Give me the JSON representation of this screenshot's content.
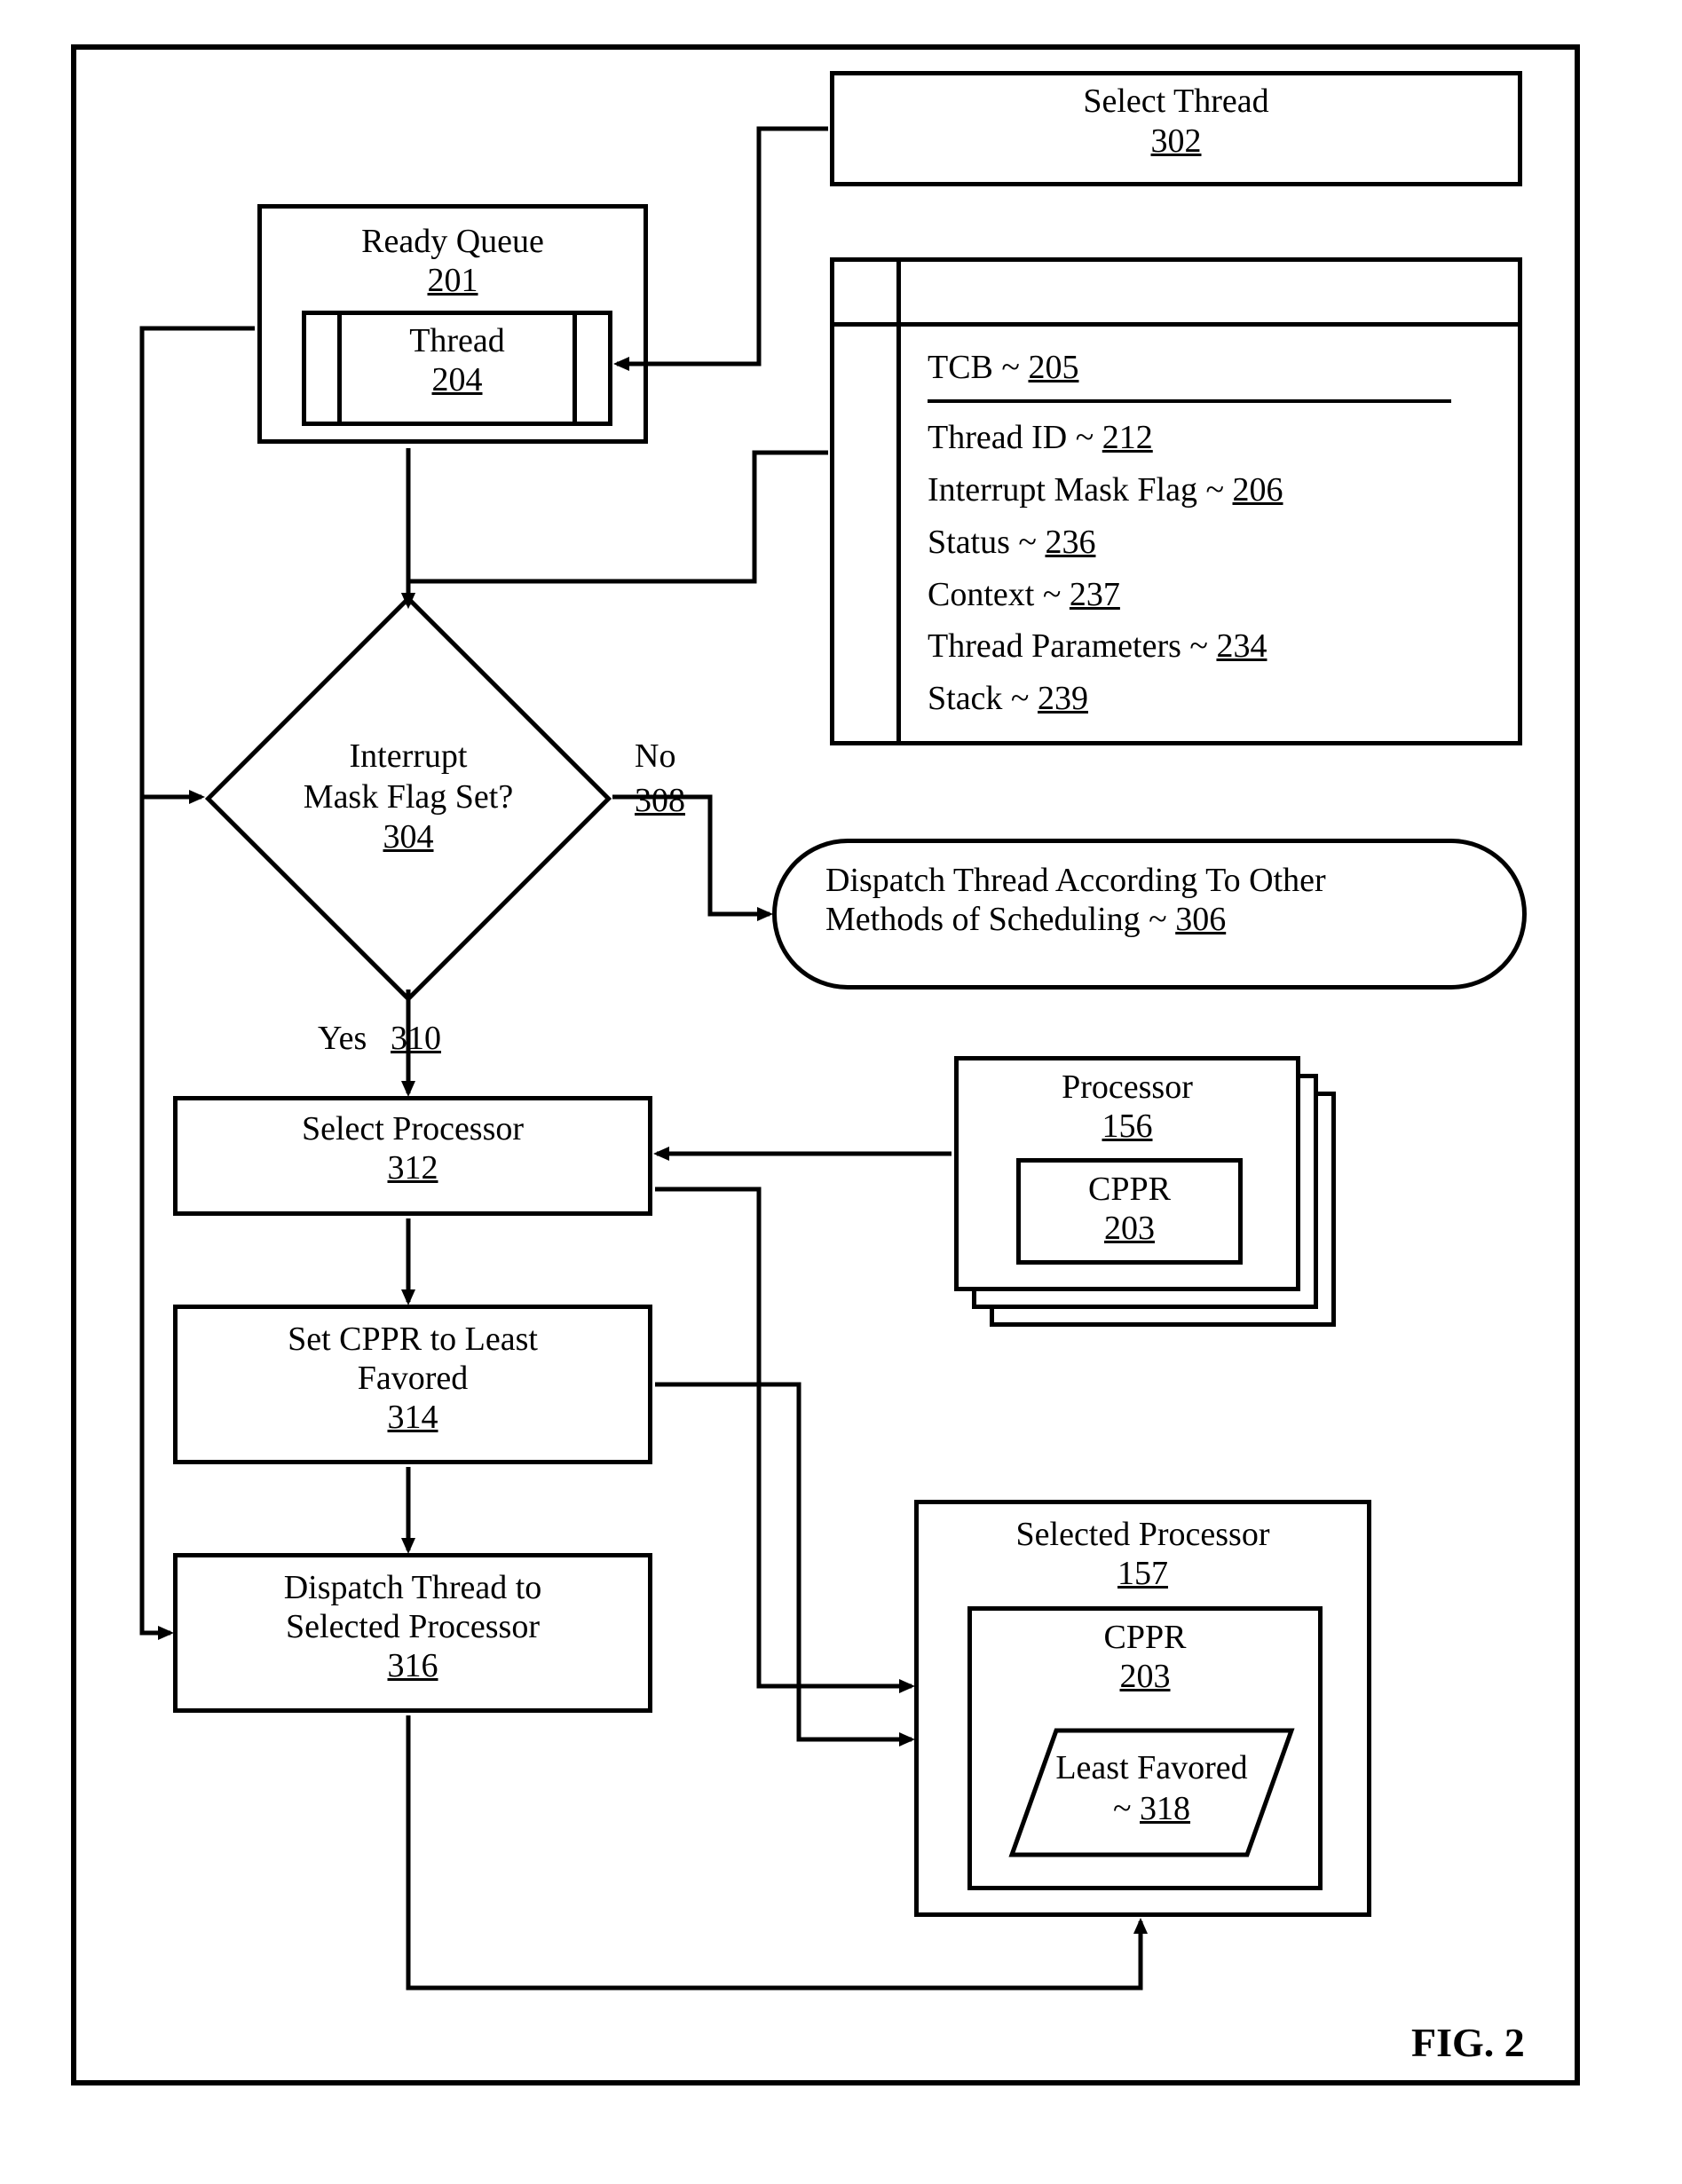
{
  "figureLabel": "FIG. 2",
  "selectThread": {
    "label": "Select Thread",
    "ref": "302"
  },
  "readyQueue": {
    "label": "Ready Queue",
    "ref": "201",
    "thread": {
      "label": "Thread",
      "ref": "204"
    }
  },
  "tcb": {
    "title_prefix": "TCB ~ ",
    "title_ref": "205",
    "rows": [
      {
        "prefix": "Thread ID ~ ",
        "ref": "212"
      },
      {
        "prefix": "Interrupt Mask Flag ~ ",
        "ref": "206"
      },
      {
        "prefix": "Status ~ ",
        "ref": "236"
      },
      {
        "prefix": "Context ~ ",
        "ref": "237"
      },
      {
        "prefix": "Thread Parameters ~ ",
        "ref": "234"
      },
      {
        "prefix": "Stack ~ ",
        "ref": "239"
      }
    ]
  },
  "decision": {
    "line1": "Interrupt",
    "line2": "Mask Flag Set?",
    "ref": "304",
    "no": {
      "label": "No",
      "ref": "308"
    },
    "yes": {
      "label": "Yes",
      "ref": "310"
    }
  },
  "dispatchOther": {
    "line1": "Dispatch Thread According To Other",
    "line2": "Methods of Scheduling ~ ",
    "ref": "306"
  },
  "selectProcessor": {
    "label": "Select Processor",
    "ref": "312"
  },
  "setCppr": {
    "line1": "Set  CPPR to Least",
    "line2": "Favored",
    "ref": "314"
  },
  "dispatchSel": {
    "line1": "Dispatch Thread to",
    "line2": "Selected Processor",
    "ref": "316"
  },
  "processor": {
    "label": "Processor",
    "ref": "156",
    "cppr": {
      "label": "CPPR",
      "ref": "203"
    }
  },
  "selectedProcessor": {
    "label": "Selected Processor",
    "ref": "157",
    "cppr": {
      "label": "CPPR",
      "ref": "203"
    },
    "least": {
      "line1": "Least Favored",
      "prefix": "~ ",
      "ref": "318"
    }
  }
}
